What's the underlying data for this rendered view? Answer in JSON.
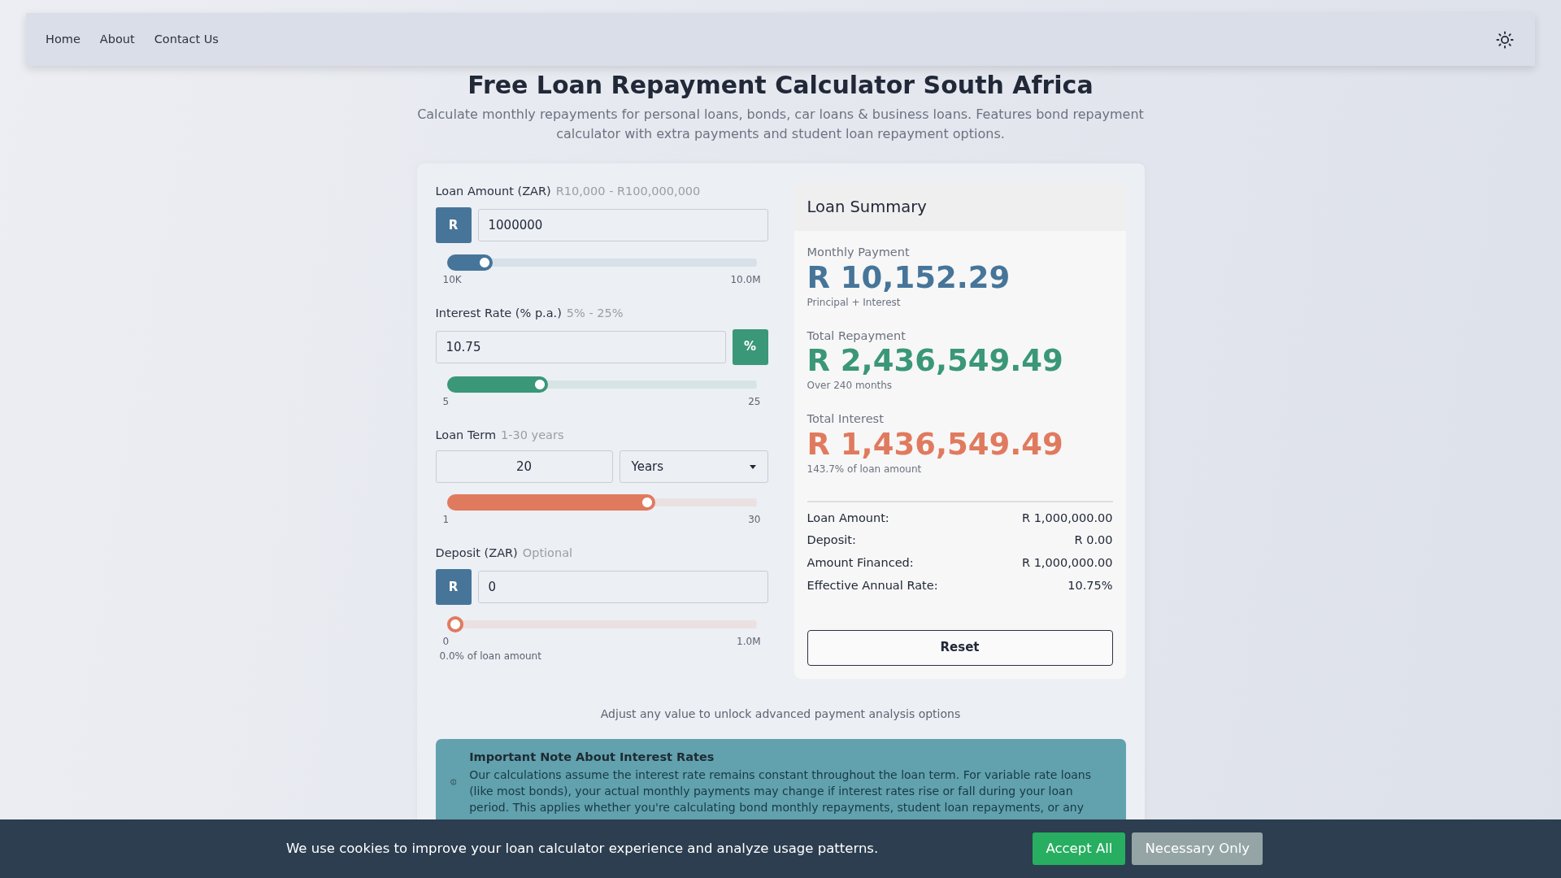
{
  "nav": {
    "links": [
      {
        "label": "Home"
      },
      {
        "label": "About"
      },
      {
        "label": "Contact Us"
      }
    ]
  },
  "page": {
    "title": "Free Loan Repayment Calculator South Africa",
    "subtitle": "Calculate monthly repayments for personal loans, bonds, car loans & business loans. Features bond repayment calculator with extra payments and student loan repayment options."
  },
  "inputs": [
    {
      "kind": "prefix",
      "label": "Loan Amount (ZAR)",
      "hint": "R10,000 - R100,000,000",
      "addon": "R",
      "value": "1000000",
      "level": 0.1,
      "min_label": "10K",
      "max_label": "10.0M",
      "color": "#467599"
    },
    {
      "kind": "suffix",
      "label": "Interest Rate (% p.a.)",
      "hint": "5% - 25%",
      "addon": "%",
      "value": "10.75",
      "level": 0.29,
      "min_label": "5",
      "max_label": "25",
      "color": "#3a9778"
    },
    {
      "kind": "unit",
      "label": "Loan Term",
      "hint": "1-30 years",
      "value": "20",
      "unit": "Years",
      "level": 0.655,
      "min_label": "1",
      "max_label": "30",
      "color": "#e07a5f"
    },
    {
      "kind": "prefix",
      "label": "Deposit (ZAR)",
      "hint": "Optional",
      "addon": "R",
      "value": "0",
      "level": 0,
      "min_label": "0",
      "max_label": "1.0M",
      "note": "0.0% of loan amount",
      "color": "#e07a5f"
    }
  ],
  "summary": {
    "title": "Loan Summary",
    "figures": [
      {
        "label": "Monthly Payment",
        "value": "R 10,152.29",
        "note": "Principal + Interest",
        "color": "#467599"
      },
      {
        "label": "Total Repayment",
        "value": "R 2,436,549.49",
        "note": "Over 240 months",
        "color": "#3a9778"
      },
      {
        "label": "Total Interest",
        "value": "R 1,436,549.49",
        "note": "143.7% of loan amount",
        "color": "#e07a5f"
      }
    ],
    "details": [
      {
        "label": "Loan Amount:",
        "value": "R 1,000,000.00"
      },
      {
        "label": "Deposit:",
        "value": "R 0.00"
      },
      {
        "label": "Amount Financed:",
        "value": "R 1,000,000.00"
      },
      {
        "label": "Effective Annual Rate:",
        "value": "10.75%"
      }
    ],
    "reset": "Reset"
  },
  "unlock_hint": "Adjust any value to unlock advanced payment analysis options",
  "note": {
    "title": "Important Note About Interest Rates",
    "text": "Our calculations assume the interest rate remains constant throughout the loan term. For variable rate loans (like most bonds), your actual monthly payments may change if interest rates rise or fall during your loan period. This applies whether you're calculating bond monthly repayments, student loan repayments, or any"
  },
  "cookie": {
    "text": "We use cookies to improve your loan calculator experience and analyze usage patterns.",
    "buttons": [
      {
        "label": "Accept All",
        "kind": "accept"
      },
      {
        "label": "Necessary Only",
        "kind": "necessary"
      }
    ]
  }
}
